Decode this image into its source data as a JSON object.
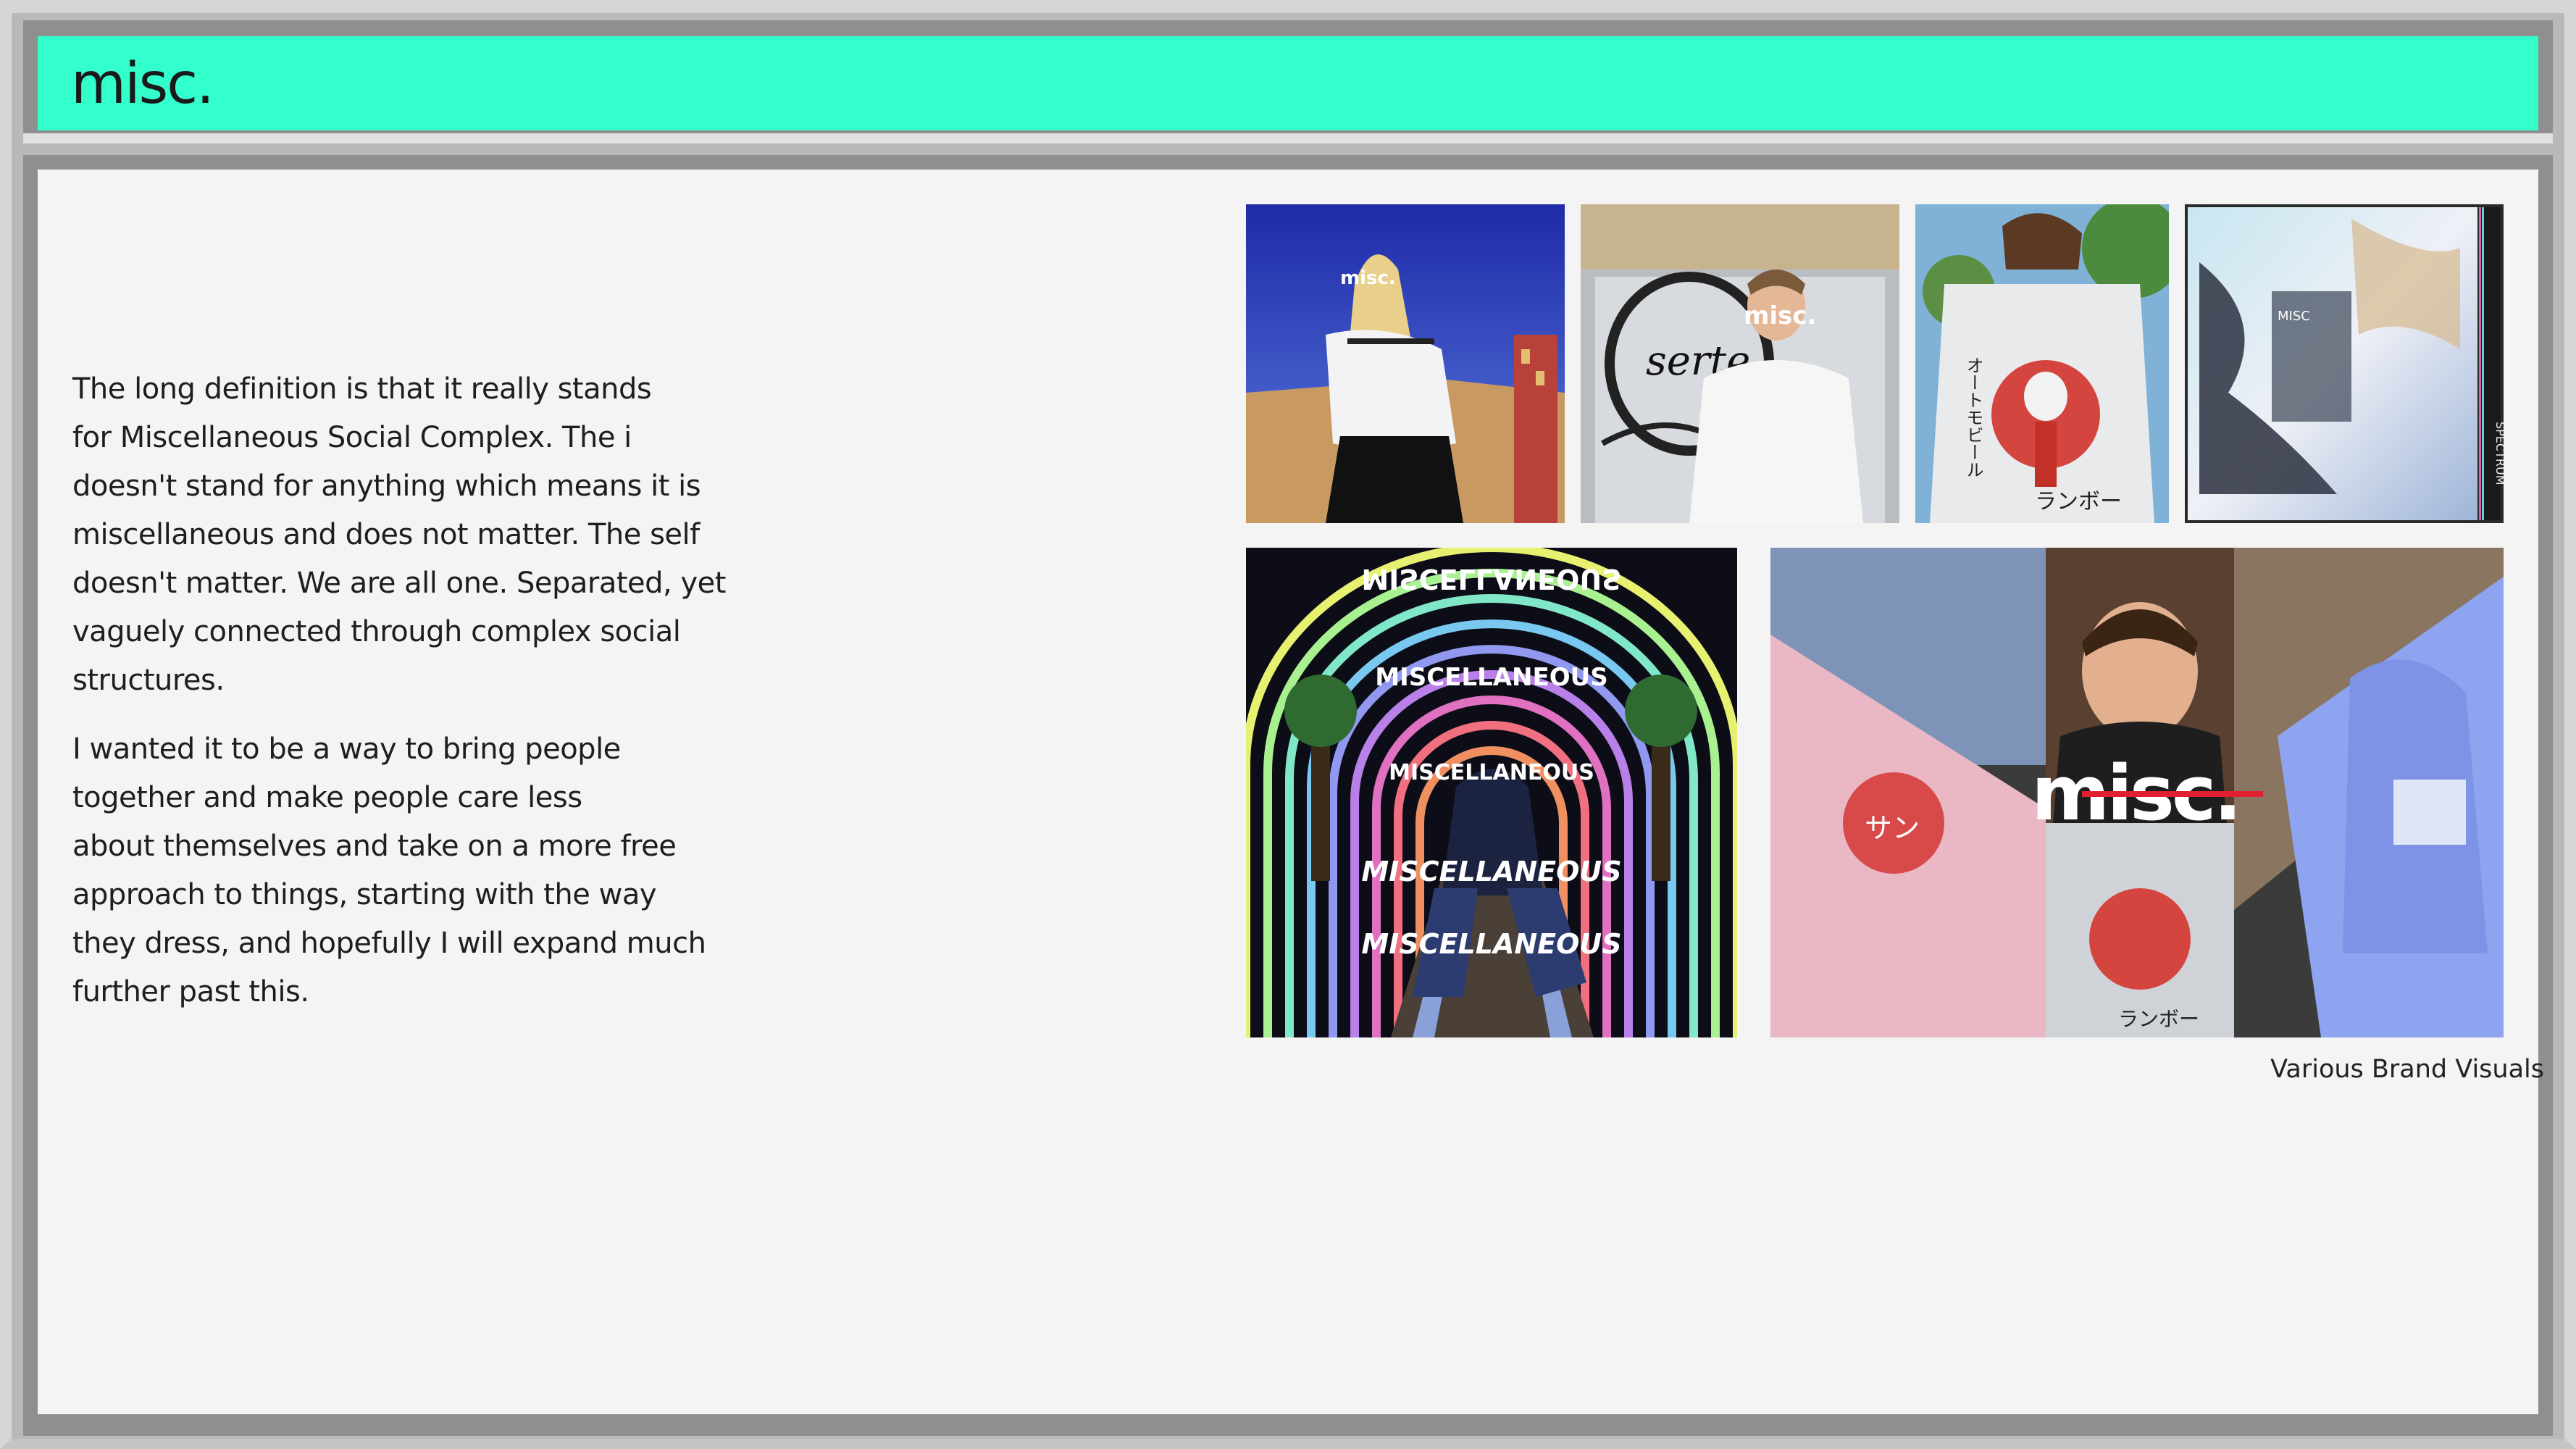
{
  "window": {
    "title": "misc."
  },
  "intro": {
    "paragraph1_lines": [
      "The long definition is that it really stands",
      "for Miscellaneous Social Complex. The i",
      "doesn't stand for anything which means it is",
      "miscellaneous and does not matter. The self",
      "doesn't matter. We are all one. Separated, yet",
      "vaguely connected through complex social",
      "structures."
    ],
    "paragraph2_lines": [
      "I wanted it to be a way to bring people",
      "together and make people care less",
      "about themselves and take on a more free",
      "approach to things, starting with the way",
      "they dress, and hopefully I will expand much",
      "further past this."
    ]
  },
  "gallery": {
    "caption": "Various Brand Visuals",
    "images": [
      {
        "name": "photo-girl-hoodie",
        "overlay_text": "misc."
      },
      {
        "name": "photo-graffiti-hoodie",
        "overlay_text": "misc.",
        "graffiti": "serte"
      },
      {
        "name": "photo-holding-shirt",
        "vertical_text": "オートモビール",
        "bottom_text": "ランボー"
      },
      {
        "name": "spectrum-cover",
        "side_text": "SPECTRUM",
        "label": "MISC"
      },
      {
        "name": "tunnel-poster",
        "texts": [
          "MISCELLANEOUS",
          "MISCELLANEOUS",
          "MISCELLANEOUS",
          "MISCELLANEOUS",
          "MISCELLANEOUS"
        ]
      },
      {
        "name": "collage-logo",
        "logo": "misc.",
        "kana": "サン",
        "bottom_text": "ランボー"
      }
    ]
  },
  "colors": {
    "accent": "#33ffcc",
    "frame_gray": "#8f8f8f",
    "content_bg": "#f4f4f4"
  }
}
